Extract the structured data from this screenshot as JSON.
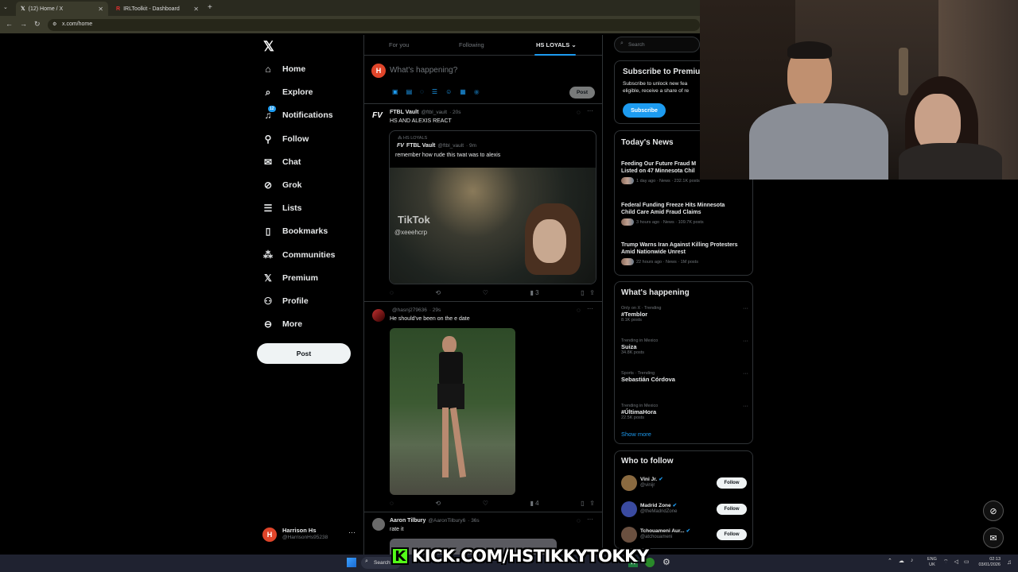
{
  "browser": {
    "tabs": [
      {
        "label": "(12) Home / X",
        "active": true
      },
      {
        "label": "IRLToolkit - Dashboard",
        "active": false
      }
    ],
    "url": "x.com/home"
  },
  "nav": {
    "items": [
      {
        "label": "Home",
        "icon": "home-icon"
      },
      {
        "label": "Explore",
        "icon": "search-icon"
      },
      {
        "label": "Notifications",
        "icon": "bell-icon",
        "badge": "12"
      },
      {
        "label": "Follow",
        "icon": "person-add-icon"
      },
      {
        "label": "Chat",
        "icon": "mail-icon"
      },
      {
        "label": "Grok",
        "icon": "grok-icon"
      },
      {
        "label": "Lists",
        "icon": "list-icon"
      },
      {
        "label": "Bookmarks",
        "icon": "bookmark-icon"
      },
      {
        "label": "Communities",
        "icon": "people-icon"
      },
      {
        "label": "Premium",
        "icon": "x-logo-icon"
      },
      {
        "label": "Profile",
        "icon": "person-icon"
      },
      {
        "label": "More",
        "icon": "more-circle-icon"
      }
    ],
    "post_label": "Post",
    "profile": {
      "initial": "H",
      "name": "Harrison Hs",
      "handle": "@HarrisonHs95238"
    }
  },
  "feed": {
    "tabs": [
      "For you",
      "Following",
      "HS LOYALS"
    ],
    "composer": {
      "initial": "H",
      "placeholder": "What's happening?",
      "post_label": "Post"
    },
    "tweets": [
      {
        "name": "FTBL Vault",
        "handle": "@ftbl_vault",
        "time": "· 20s",
        "text": "HS AND ALEXIS REACT",
        "quote": {
          "community": "HS LOYALS",
          "name": "FTBL Vault",
          "handle": "@ftbl_vault",
          "time": "· 9m",
          "text": "remember how rude this twat was to alexis",
          "watermark": "TikTok",
          "watermark_handle": "@xeeehcrp"
        },
        "views": "3"
      },
      {
        "name": "",
        "handle": "@hasnj279636",
        "time": "· 29s",
        "text": "He should've been on the e date",
        "views": "4"
      },
      {
        "name": "Aaron Tilbury",
        "handle": "@AaronTilbury6",
        "time": "· 36s",
        "text": "rate it"
      }
    ]
  },
  "right": {
    "search_placeholder": "Search",
    "premium": {
      "title": "Subscribe to Premiu",
      "desc_line1": "Subscribe to unlock new fea",
      "desc_line2": "eligible, receive a share of re",
      "button": "Subscribe"
    },
    "news": {
      "title": "Today's News",
      "items": [
        {
          "headline_line1": "Feeding Our Future Fraud M",
          "headline_line2": "Listed on 47 Minnesota Chil",
          "meta": "1 day ago · News · 232.1K posts"
        },
        {
          "headline_line1": "Federal Funding Freeze Hits Minnesota",
          "headline_line2": "Child Care Amid Fraud Claims",
          "meta": "3 hours ago · News · 109.7K posts"
        },
        {
          "headline_line1": "Trump Warns Iran Against Killing Protesters",
          "headline_line2": "Amid Nationwide Unrest",
          "meta": "22 hours ago · News · 1M posts"
        }
      ]
    },
    "happening": {
      "title": "What's happening",
      "items": [
        {
          "meta": "Only on X · Trending",
          "name": "#Temblor",
          "posts": "8.1K posts"
        },
        {
          "meta": "Trending in Mexico",
          "name": "Suiza",
          "posts": "34.8K posts"
        },
        {
          "meta": "Sports · Trending",
          "name": "Sebastián Córdova",
          "posts": ""
        },
        {
          "meta": "Trending in Mexico",
          "name": "#ÚltimaHora",
          "posts": "22.5K posts"
        }
      ],
      "show_more": "Show more"
    },
    "who_to_follow": {
      "title": "Who to follow",
      "items": [
        {
          "name": "Vini Jr.",
          "handle": "@vinijr",
          "button": "Follow"
        },
        {
          "name": "Madrid Zone",
          "handle": "@theMadridZone",
          "button": "Follow"
        },
        {
          "name": "Tchouameni Aur...",
          "handle": "@atchouameni",
          "button": "Follow"
        }
      ]
    }
  },
  "overlay": {
    "kick_text": "KICK.COM/HSTIKKYTOKKY"
  },
  "taskbar": {
    "search": "Search",
    "lang": "ENG",
    "region": "UK",
    "time": "02:13",
    "date": "03/01/2026"
  },
  "colors": {
    "accent": "#1d9bf0",
    "kick_green": "#53fc18",
    "avatar": "#e0452a"
  }
}
